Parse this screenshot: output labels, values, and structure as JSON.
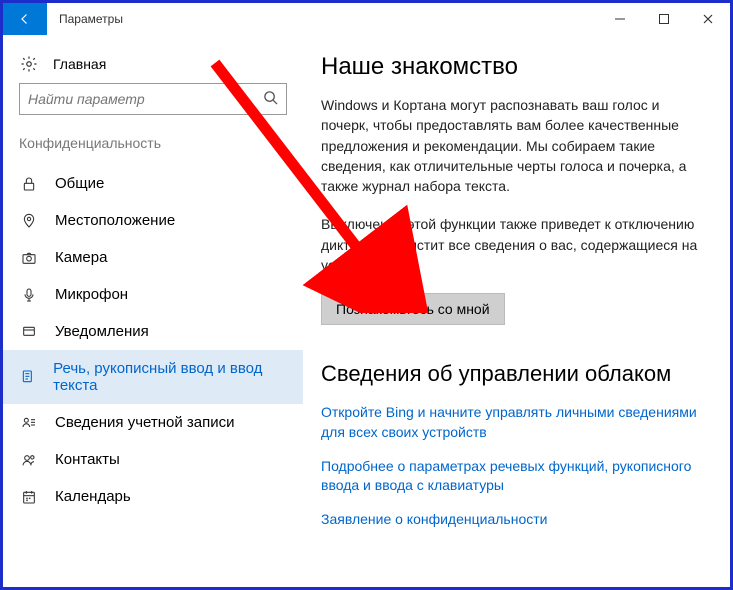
{
  "titlebar": {
    "title": "Параметры"
  },
  "sidebar": {
    "home_label": "Главная",
    "search_placeholder": "Найти параметр",
    "section": "Конфиденциальность",
    "items": [
      {
        "label": "Общие"
      },
      {
        "label": "Местоположение"
      },
      {
        "label": "Камера"
      },
      {
        "label": "Микрофон"
      },
      {
        "label": "Уведомления"
      },
      {
        "label": "Речь, рукописный ввод и ввод текста"
      },
      {
        "label": "Сведения учетной записи"
      },
      {
        "label": "Контакты"
      },
      {
        "label": "Календарь"
      }
    ]
  },
  "content": {
    "heading1": "Наше знакомство",
    "para1": "Windows и Кортана могут распознавать ваш голос и почерк, чтобы предоставлять вам более качественные предложения и рекомендации. Мы собираем такие сведения, как отличительные черты голоса и почерка, а также журнал набора текста.",
    "para2": "Выключение этой функции также приведет к отключению диктовки и очистит все сведения о вас, содержащиеся на устройстве.",
    "button": "Познакомьтесь со мной",
    "heading2": "Сведения об управлении облаком",
    "link1": "Откройте Bing и начните управлять личными сведениями для всех своих устройств",
    "link2": "Подробнее о параметрах речевых функций, рукописного ввода и ввода с клавиатуры",
    "link3": "Заявление о конфиденциальности"
  },
  "colors": {
    "accent": "#0078d7",
    "link": "#0066cc"
  }
}
